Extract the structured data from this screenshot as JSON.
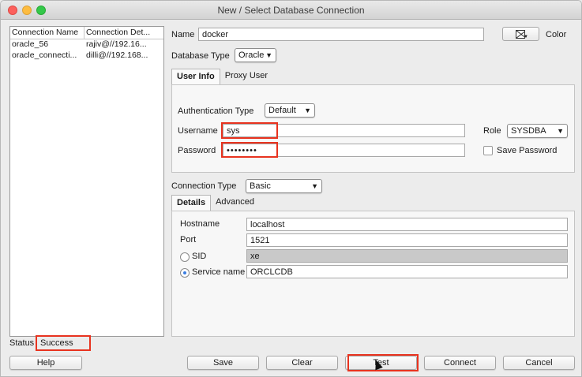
{
  "window": {
    "title": "New / Select Database Connection"
  },
  "connections": {
    "headers": [
      "Connection Name",
      "Connection Det..."
    ],
    "rows": [
      [
        "oracle_56",
        "rajiv@//192.16..."
      ],
      [
        "oracle_connecti...",
        "dilli@//192.168..."
      ]
    ]
  },
  "status": {
    "label": "Status",
    "value": "Success"
  },
  "form": {
    "name_label": "Name",
    "name_value": "docker",
    "color_label": "Color",
    "database_type_label": "Database Type",
    "database_type_value": "Oracle",
    "tabs": [
      "User Info",
      "Proxy User"
    ],
    "auth_type_label": "Authentication Type",
    "auth_type_value": "Default",
    "username_label": "Username",
    "username_value": "sys",
    "password_label": "Password",
    "password_value": "••••••••",
    "role_label": "Role",
    "role_value": "SYSDBA",
    "save_password_label": "Save Password",
    "connection_type_label": "Connection Type",
    "connection_type_value": "Basic",
    "detail_tabs": [
      "Details",
      "Advanced"
    ],
    "hostname_label": "Hostname",
    "hostname_value": "localhost",
    "port_label": "Port",
    "port_value": "1521",
    "sid_label": "SID",
    "sid_value": "xe",
    "service_name_label": "Service name",
    "service_name_value": "ORCLCDB"
  },
  "buttons": {
    "help": "Help",
    "save": "Save",
    "clear": "Clear",
    "test": "Test",
    "connect": "Connect",
    "cancel": "Cancel"
  },
  "colors": {
    "highlight": "#e8331f",
    "radio_selected": "#3b7de0"
  }
}
